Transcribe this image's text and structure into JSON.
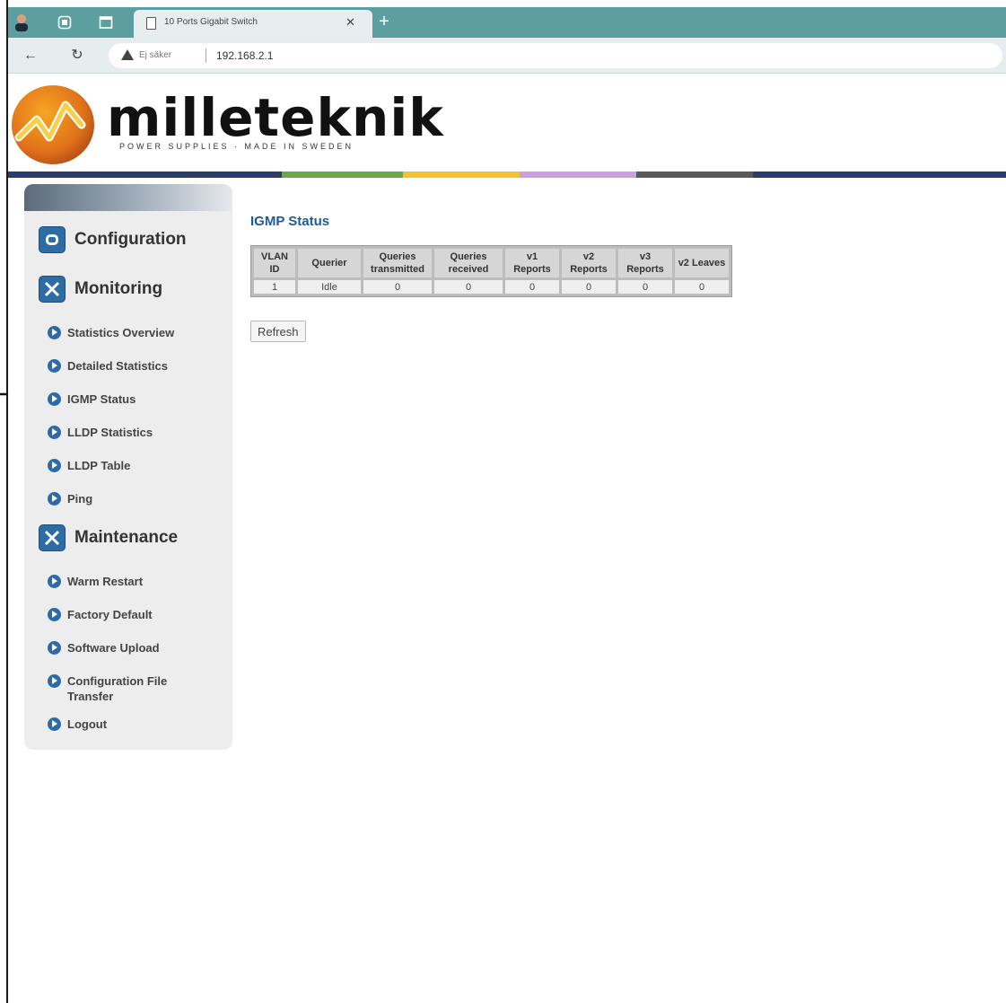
{
  "browser": {
    "tab_title": "10 Ports Gigabit Switch",
    "new_tab_label": "+",
    "address": {
      "security_label": "Ej säker",
      "url": "192.168.2.1"
    }
  },
  "header": {
    "logo_text": "milleteknik",
    "tagline": "POWER SUPPLIES · MADE IN SWEDEN",
    "color_bar": [
      "#2b3d6b",
      "#6aa84f",
      "#f1c232",
      "#c9a0dc",
      "#595959",
      "#2b3d6b"
    ]
  },
  "sidebar": {
    "sections": [
      {
        "label": "Configuration",
        "icon": "configuration-icon",
        "items": []
      },
      {
        "label": "Monitoring",
        "icon": "tools-icon",
        "items": [
          {
            "label": "Statistics Overview"
          },
          {
            "label": "Detailed Statistics"
          },
          {
            "label": "IGMP Status",
            "selected": true
          },
          {
            "label": "LLDP Statistics"
          },
          {
            "label": "LLDP Table"
          },
          {
            "label": "Ping"
          }
        ]
      },
      {
        "label": "Maintenance",
        "icon": "tools-icon",
        "items": [
          {
            "label": "Warm Restart"
          },
          {
            "label": "Factory Default"
          },
          {
            "label": "Software Upload"
          },
          {
            "label": "Configuration File Transfer"
          },
          {
            "label": "Logout"
          }
        ]
      }
    ]
  },
  "main": {
    "title": "IGMP Status",
    "table": {
      "headers": [
        "VLAN ID",
        "Querier",
        "Queries transmitted",
        "Queries received",
        "v1 Reports",
        "v2 Reports",
        "v3 Reports",
        "v2 Leaves"
      ],
      "rows": [
        [
          "1",
          "Idle",
          "0",
          "0",
          "0",
          "0",
          "0",
          "0"
        ]
      ]
    },
    "refresh_label": "Refresh"
  }
}
